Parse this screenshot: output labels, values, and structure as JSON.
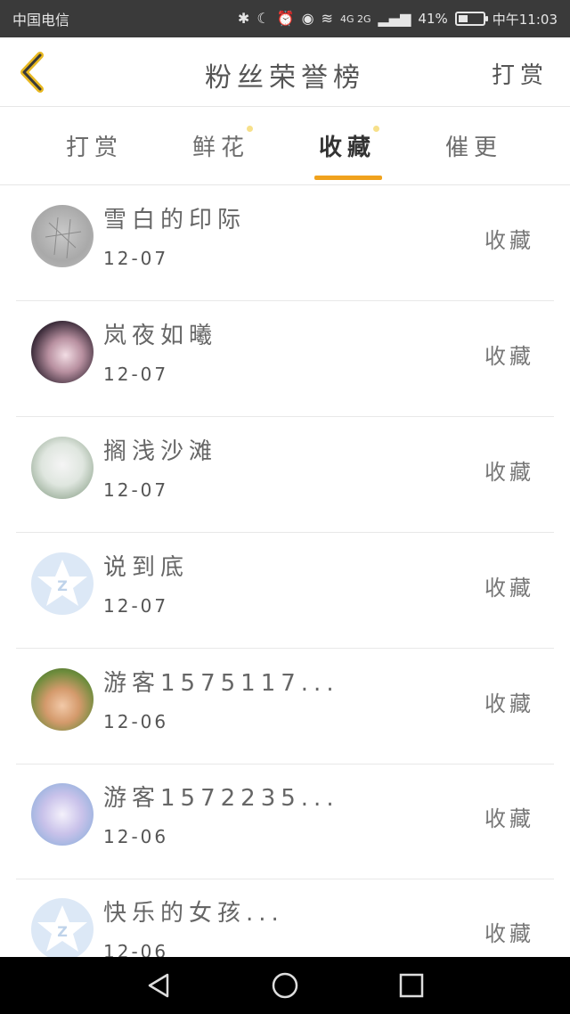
{
  "status_bar": {
    "carrier": "中国电信",
    "network": "4G 2G",
    "battery_percent": "41%",
    "battery_level": 0.41,
    "time": "中午11:03"
  },
  "header": {
    "title": "粉丝荣誉榜",
    "action": "打赏"
  },
  "tabs": [
    {
      "label": "打赏"
    },
    {
      "label": "鲜花"
    },
    {
      "label": "收藏"
    },
    {
      "label": "催更"
    }
  ],
  "active_tab": "收藏",
  "fans": [
    {
      "name": "雪白的印际",
      "date": "12-07",
      "action": "收藏"
    },
    {
      "name": "岚夜如曦",
      "date": "12-07",
      "action": "收藏"
    },
    {
      "name": "搁浅沙滩",
      "date": "12-07",
      "action": "收藏"
    },
    {
      "name": "说到底",
      "date": "12-07",
      "action": "收藏"
    },
    {
      "name": "游客1575117...",
      "date": "12-06",
      "action": "收藏"
    },
    {
      "name": "游客1572235...",
      "date": "12-06",
      "action": "收藏"
    },
    {
      "name": "快乐的女孩...",
      "date": "12-06",
      "action": "收藏"
    }
  ],
  "colors": {
    "accent": "#f0a21d",
    "status_bar": "#3a3a3a",
    "text": "#666666"
  }
}
